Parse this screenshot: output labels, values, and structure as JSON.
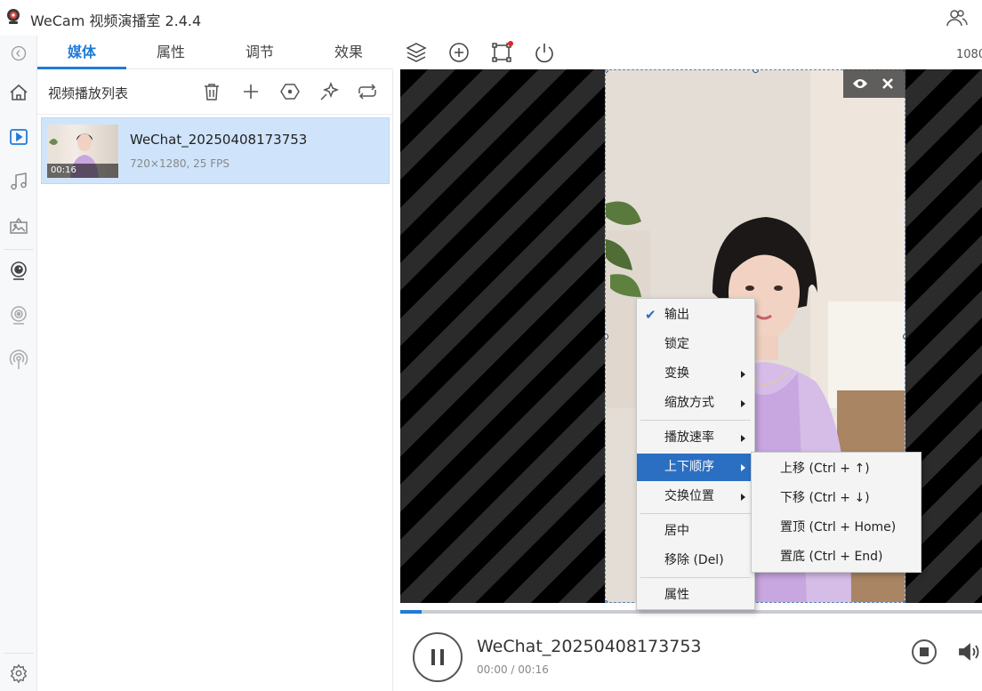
{
  "app": {
    "title": "WeCam 视频演播室 2.4.4",
    "resolution_label": "1080"
  },
  "tabs": [
    {
      "label": "媒体",
      "active": true
    },
    {
      "label": "属性",
      "active": false
    },
    {
      "label": "调节",
      "active": false
    },
    {
      "label": "效果",
      "active": false
    }
  ],
  "rail_icons": [
    "collapse-icon",
    "home-icon",
    "video-play-icon",
    "music-note-icon",
    "image-icon",
    "webcam-icon",
    "virtual-camera-icon",
    "broadcast-icon",
    "settings-gear-icon"
  ],
  "playlist": {
    "title": "视频播放列表",
    "items": [
      {
        "name": "WeChat_20250408173753",
        "meta": "720×1280, 25 FPS",
        "duration": "00:16",
        "selected": true
      }
    ]
  },
  "player": {
    "title": "WeChat_20250408173753",
    "time": "00:00 / 00:16",
    "progress": 0.036
  },
  "context_menu": {
    "items": [
      {
        "label": "输出",
        "checked": true,
        "submenu": false
      },
      {
        "label": "锁定",
        "checked": false,
        "submenu": false
      },
      {
        "label": "变换",
        "checked": false,
        "submenu": true
      },
      {
        "label": "缩放方式",
        "checked": false,
        "submenu": true
      },
      {
        "label": "播放速率",
        "checked": false,
        "submenu": true
      },
      {
        "label": "上下顺序",
        "checked": false,
        "submenu": true,
        "highlighted": true
      },
      {
        "label": "交换位置",
        "checked": false,
        "submenu": true
      },
      {
        "label": "居中",
        "checked": false,
        "submenu": false
      },
      {
        "label": "移除 (Del)",
        "checked": false,
        "submenu": false
      },
      {
        "label": "属性",
        "checked": false,
        "submenu": false
      }
    ],
    "submenu": [
      {
        "label": "上移  (Ctrl + ↑)"
      },
      {
        "label": "下移  (Ctrl + ↓)"
      },
      {
        "label": "置顶  (Ctrl + Home)"
      },
      {
        "label": "置底  (Ctrl + End)"
      }
    ]
  },
  "colors": {
    "accent": "#1f7bd8",
    "menu_highlight": "#2b6fc2",
    "selected_row": "#cfe4fb",
    "notification_dot": "#e8202a"
  }
}
